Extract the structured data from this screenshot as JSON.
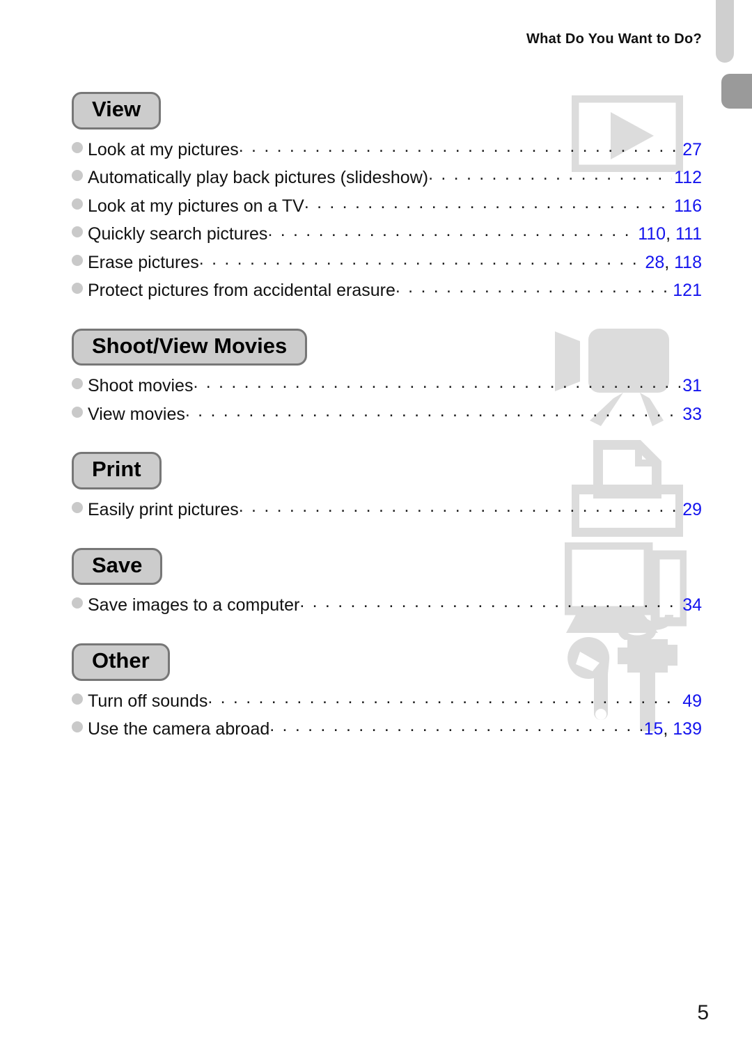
{
  "header": {
    "running_title": "What Do You Want to Do?"
  },
  "folio": {
    "page_number": "5"
  },
  "colors": {
    "page_number_blue": "#1414ee",
    "pill_fill": "#cccccc",
    "pill_border": "#777777",
    "bullet_gray": "#c9c9c9",
    "watermark_gray": "#dcdcdc",
    "edge_tab_light": "#cfcfcf",
    "edge_tab_dark": "#9a9a9a"
  },
  "sections": [
    {
      "id": "view",
      "title": "View",
      "icon": "play-screen-icon",
      "entries": [
        {
          "label": "Look at my pictures",
          "pages": "27"
        },
        {
          "label": "Automatically play back pictures (slideshow)",
          "pages": "112"
        },
        {
          "label": "Look at my pictures on a TV",
          "pages": "116"
        },
        {
          "label": "Quickly search pictures",
          "pages": "110, 111"
        },
        {
          "label": "Erase pictures",
          "pages": "28, 118"
        },
        {
          "label": "Protect pictures from accidental erasure",
          "pages": "121"
        }
      ]
    },
    {
      "id": "shoot-view-movies",
      "title": "Shoot/View Movies",
      "icon": "video-camera-icon",
      "entries": [
        {
          "label": "Shoot movies",
          "pages": "31"
        },
        {
          "label": "View movies",
          "pages": "33"
        }
      ]
    },
    {
      "id": "print",
      "title": "Print",
      "icon": "printer-icon",
      "entries": [
        {
          "label": "Easily print pictures",
          "pages": "29"
        }
      ]
    },
    {
      "id": "save",
      "title": "Save",
      "icon": "computer-icon",
      "entries": [
        {
          "label": "Save images to a computer",
          "pages": "34"
        }
      ]
    },
    {
      "id": "other",
      "title": "Other",
      "icon": "tools-icon",
      "entries": [
        {
          "label": "Turn off sounds",
          "pages": "49"
        },
        {
          "label": "Use the camera abroad",
          "pages": "15, 139"
        }
      ]
    }
  ]
}
